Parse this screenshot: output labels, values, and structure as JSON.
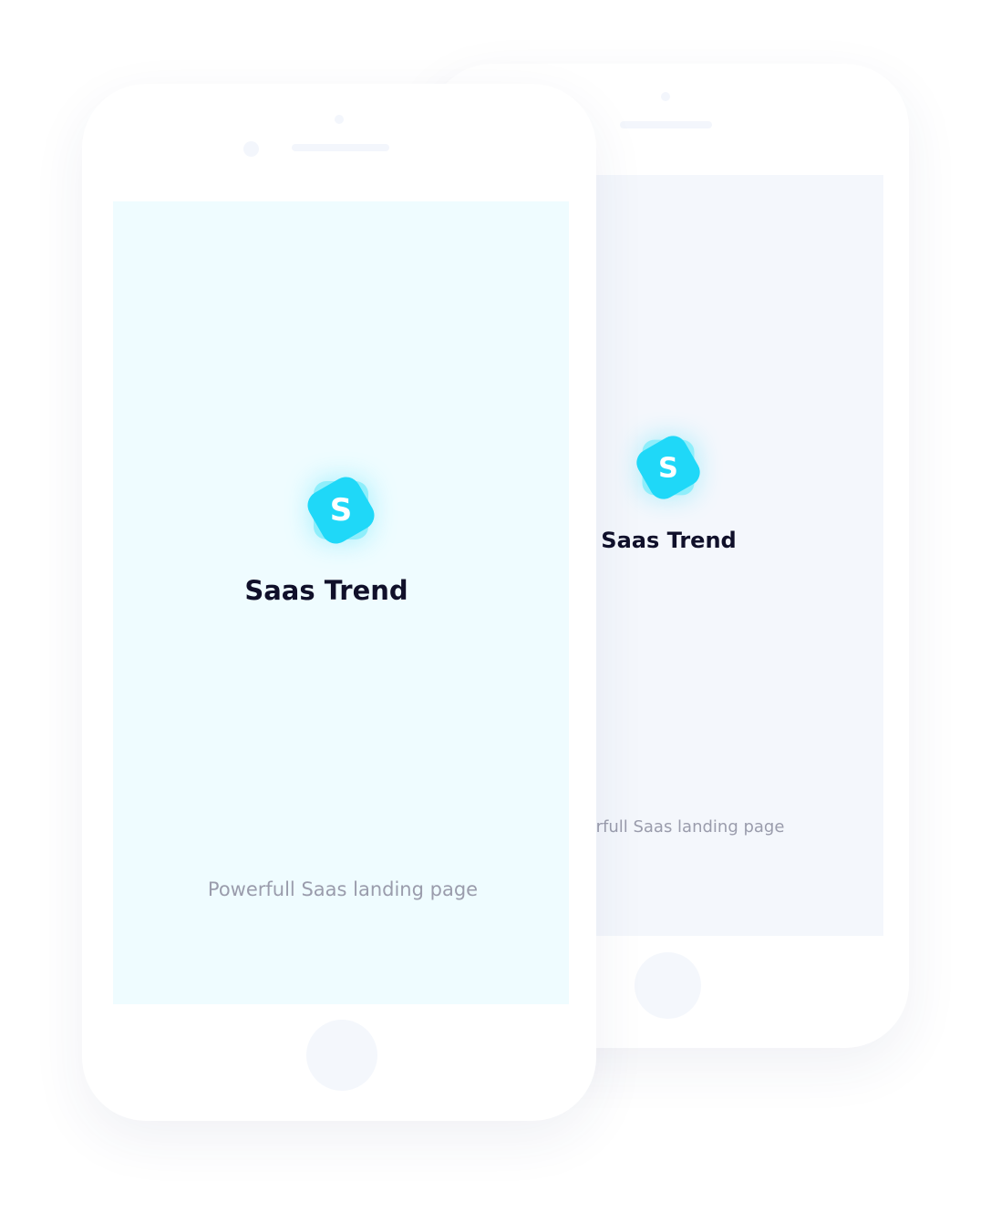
{
  "back_phone": {
    "app_name": "Saas Trend",
    "tagline": "Powerfull Saas landing page",
    "logo_letter": "S"
  },
  "front_phone": {
    "app_name": "Saas Trend",
    "tagline": "Powerfull Saas landing page",
    "logo_letter": "S"
  },
  "colors": {
    "accent": "#1fd8f8",
    "front_screen": "#effcff",
    "back_screen": "#f4f7fc",
    "title": "#10102a",
    "tagline": "#9a9cac"
  }
}
